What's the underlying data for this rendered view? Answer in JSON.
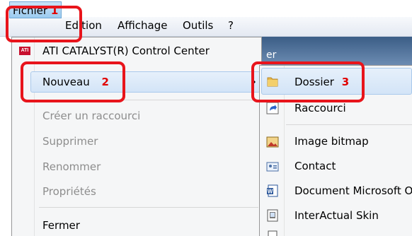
{
  "menubar": {
    "items": [
      "Fichier",
      "Edition",
      "Affichage",
      "Outils",
      "?"
    ]
  },
  "annotations": {
    "n1": "1",
    "n2": "2",
    "n3": "3"
  },
  "file_menu": {
    "header_item": "ATI CATALYST(R) Control Center",
    "nouveau": "Nouveau",
    "create_shortcut": "Créer un raccourci",
    "delete": "Supprimer",
    "rename": "Renommer",
    "properties": "Propriétés",
    "close": "Fermer"
  },
  "new_submenu": {
    "items": [
      "Dossier",
      "Raccourci",
      "Image bitmap",
      "Contact",
      "Document Microsoft O",
      "InterActual Skin"
    ]
  },
  "bg_window_title_fragment": "er",
  "colors": {
    "highlight_box": "#e8141b",
    "number": "#e00000",
    "selection": "#d3e4f7"
  },
  "icons": {
    "ati": "ati-logo-icon",
    "folder": "folder-icon",
    "shortcut": "shortcut-icon",
    "bitmap": "bitmap-image-icon",
    "contact": "contact-card-icon",
    "word": "word-document-icon",
    "skin": "skin-file-icon"
  }
}
